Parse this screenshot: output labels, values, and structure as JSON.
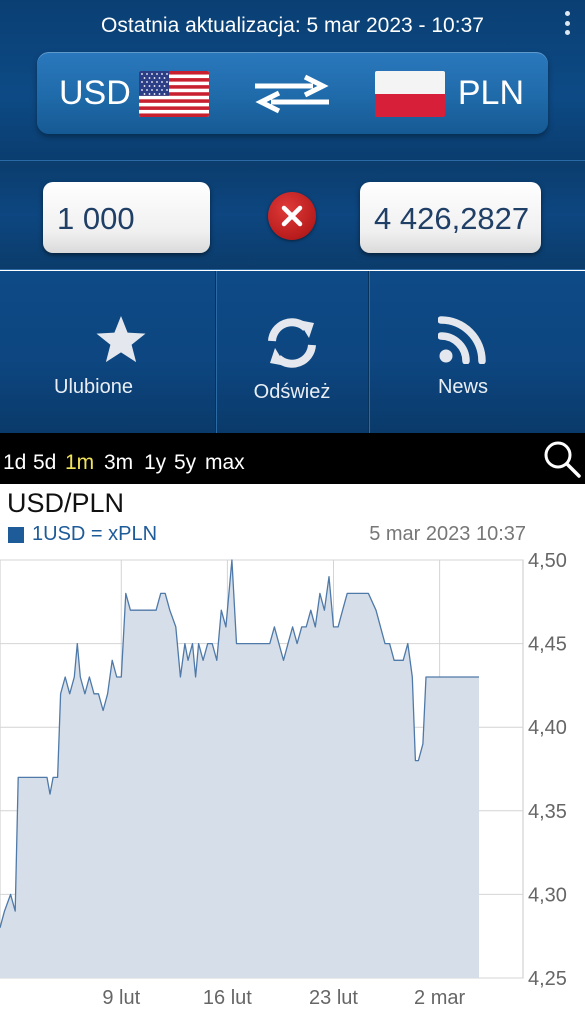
{
  "header": {
    "last_update": "Ostatnia aktualizacja: 5 mar 2023 - 10:37",
    "menu_icon": "overflow-menu-icon"
  },
  "pair": {
    "from_code": "USD",
    "to_code": "PLN",
    "from_flag": "us-flag-icon",
    "to_flag": "pl-flag-icon",
    "swap_icon": "swap-arrows-icon"
  },
  "amounts": {
    "from_value": "1 000",
    "to_value": "4 426,2827",
    "clear_icon": "clear-icon"
  },
  "actions": [
    {
      "label": "Ulubione",
      "icon": "star-icon"
    },
    {
      "label": "Odśwież",
      "icon": "refresh-icon"
    },
    {
      "label": "News",
      "icon": "rss-icon"
    }
  ],
  "ranges": {
    "items": [
      "1d",
      "5d",
      "1m",
      "3m",
      "1y",
      "5y",
      "max"
    ],
    "active": "1m",
    "search_icon": "search-icon"
  },
  "colors": {
    "header_blue": "#0d4680",
    "active_range": "#f2e35c",
    "series": "#1e5b99",
    "area_fill": "#d6dfe9",
    "clear_red": "#c62828"
  },
  "chart_data": {
    "type": "area",
    "title": "USD/PLN",
    "timestamp": "5 mar 2023 10:37",
    "series_name": "1USD = xPLN",
    "ylim": [
      4.25,
      4.5
    ],
    "y_ticks": [
      "4,50",
      "4,45",
      "4,40",
      "4,35",
      "4,30",
      "4,25"
    ],
    "y_tick_values": [
      4.5,
      4.45,
      4.4,
      4.35,
      4.3,
      4.25
    ],
    "x_ticks": [
      "9 lut",
      "16 lut",
      "23 lut",
      "2 mar"
    ],
    "x_tick_days": [
      8,
      15,
      22,
      29
    ],
    "x_domain_days": [
      0,
      34.5
    ],
    "x_domain_note": "days since 1 lut 2023",
    "grid": true,
    "points": [
      [
        0.0,
        4.28
      ],
      [
        0.3,
        4.29
      ],
      [
        0.7,
        4.3
      ],
      [
        1.0,
        4.29
      ],
      [
        1.2,
        4.37
      ],
      [
        1.5,
        4.37
      ],
      [
        2.0,
        4.37
      ],
      [
        2.6,
        4.37
      ],
      [
        3.1,
        4.37
      ],
      [
        3.3,
        4.36
      ],
      [
        3.5,
        4.37
      ],
      [
        3.8,
        4.37
      ],
      [
        4.0,
        4.42
      ],
      [
        4.3,
        4.43
      ],
      [
        4.6,
        4.42
      ],
      [
        4.9,
        4.43
      ],
      [
        5.1,
        4.45
      ],
      [
        5.3,
        4.43
      ],
      [
        5.6,
        4.42
      ],
      [
        5.9,
        4.43
      ],
      [
        6.2,
        4.42
      ],
      [
        6.5,
        4.42
      ],
      [
        6.8,
        4.41
      ],
      [
        7.1,
        4.42
      ],
      [
        7.4,
        4.44
      ],
      [
        7.7,
        4.43
      ],
      [
        8.0,
        4.43
      ],
      [
        8.3,
        4.48
      ],
      [
        8.6,
        4.47
      ],
      [
        9.0,
        4.47
      ],
      [
        9.4,
        4.47
      ],
      [
        9.8,
        4.47
      ],
      [
        10.3,
        4.47
      ],
      [
        10.6,
        4.48
      ],
      [
        10.9,
        4.48
      ],
      [
        11.2,
        4.47
      ],
      [
        11.6,
        4.46
      ],
      [
        11.9,
        4.43
      ],
      [
        12.2,
        4.45
      ],
      [
        12.4,
        4.44
      ],
      [
        12.7,
        4.45
      ],
      [
        12.9,
        4.43
      ],
      [
        13.1,
        4.45
      ],
      [
        13.4,
        4.44
      ],
      [
        13.7,
        4.45
      ],
      [
        14.0,
        4.45
      ],
      [
        14.3,
        4.44
      ],
      [
        14.6,
        4.47
      ],
      [
        14.9,
        4.46
      ],
      [
        15.1,
        4.48
      ],
      [
        15.3,
        4.5
      ],
      [
        15.6,
        4.45
      ],
      [
        15.9,
        4.45
      ],
      [
        16.5,
        4.45
      ],
      [
        17.2,
        4.45
      ],
      [
        17.8,
        4.45
      ],
      [
        18.1,
        4.46
      ],
      [
        18.4,
        4.45
      ],
      [
        18.7,
        4.44
      ],
      [
        19.0,
        4.45
      ],
      [
        19.3,
        4.46
      ],
      [
        19.6,
        4.45
      ],
      [
        19.9,
        4.46
      ],
      [
        20.2,
        4.46
      ],
      [
        20.5,
        4.47
      ],
      [
        20.8,
        4.46
      ],
      [
        21.1,
        4.48
      ],
      [
        21.4,
        4.47
      ],
      [
        21.7,
        4.49
      ],
      [
        22.0,
        4.46
      ],
      [
        22.3,
        4.46
      ],
      [
        22.6,
        4.47
      ],
      [
        22.9,
        4.48
      ],
      [
        23.2,
        4.48
      ],
      [
        23.7,
        4.48
      ],
      [
        24.3,
        4.48
      ],
      [
        24.8,
        4.47
      ],
      [
        25.1,
        4.46
      ],
      [
        25.4,
        4.45
      ],
      [
        25.7,
        4.45
      ],
      [
        26.0,
        4.44
      ],
      [
        26.3,
        4.44
      ],
      [
        26.6,
        4.44
      ],
      [
        26.9,
        4.45
      ],
      [
        27.2,
        4.43
      ],
      [
        27.4,
        4.38
      ],
      [
        27.6,
        4.38
      ],
      [
        27.9,
        4.39
      ],
      [
        28.1,
        4.43
      ],
      [
        28.4,
        4.43
      ],
      [
        28.7,
        4.43
      ],
      [
        29.0,
        4.43
      ],
      [
        29.3,
        4.43
      ],
      [
        29.6,
        4.43
      ],
      [
        30.0,
        4.43
      ],
      [
        30.5,
        4.43
      ],
      [
        31.2,
        4.43
      ],
      [
        31.6,
        4.43
      ]
    ]
  }
}
